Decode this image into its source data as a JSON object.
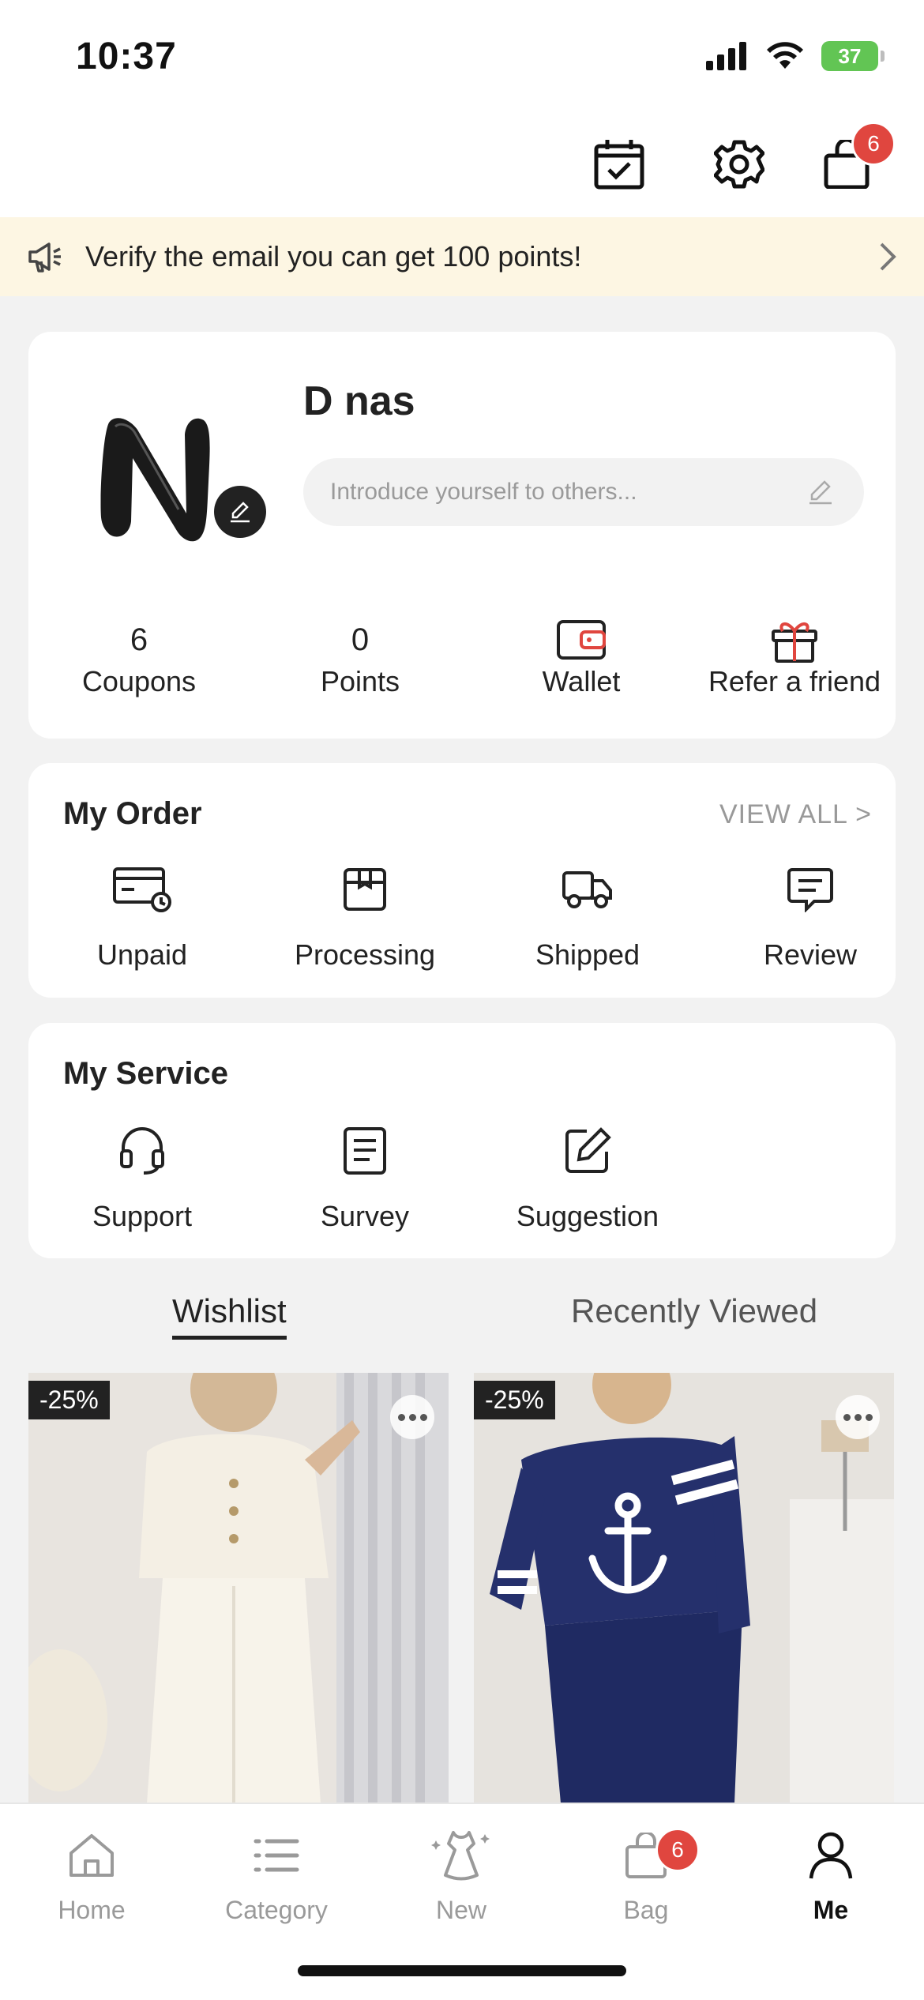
{
  "status_bar": {
    "time": "10:37",
    "battery": "37"
  },
  "header": {
    "bag_badge": "6"
  },
  "banner": {
    "text": "Verify the email you can get 100 points!"
  },
  "profile": {
    "username": "D nas",
    "bio_placeholder": "Introduce yourself to others...",
    "stats": [
      {
        "value": "6",
        "label": "Coupons"
      },
      {
        "value": "0",
        "label": "Points"
      },
      {
        "label": "Wallet",
        "icon": "wallet-icon"
      },
      {
        "label": "Refer a friend",
        "icon": "gift-icon"
      }
    ]
  },
  "orders": {
    "title": "My Order",
    "view_all": "VIEW ALL >",
    "items": [
      {
        "label": "Unpaid",
        "icon": "card-clock-icon"
      },
      {
        "label": "Processing",
        "icon": "box-icon"
      },
      {
        "label": "Shipped",
        "icon": "truck-icon"
      },
      {
        "label": "Review",
        "icon": "comment-icon"
      }
    ]
  },
  "service": {
    "title": "My Service",
    "items": [
      {
        "label": "Support",
        "icon": "headset-icon"
      },
      {
        "label": "Survey",
        "icon": "document-icon"
      },
      {
        "label": "Suggestion",
        "icon": "edit-icon"
      }
    ]
  },
  "tabs": {
    "wishlist": "Wishlist",
    "recently_viewed": "Recently Viewed"
  },
  "products": [
    {
      "discount": "-25%"
    },
    {
      "discount": "-25%"
    }
  ],
  "bottom_nav": {
    "home": "Home",
    "category": "Category",
    "new": "New",
    "bag": "Bag",
    "bag_badge": "6",
    "me": "Me"
  },
  "colors": {
    "accent_badge": "#e0463f",
    "banner_bg": "#fdf6e3",
    "gift_red": "#e0463f"
  }
}
